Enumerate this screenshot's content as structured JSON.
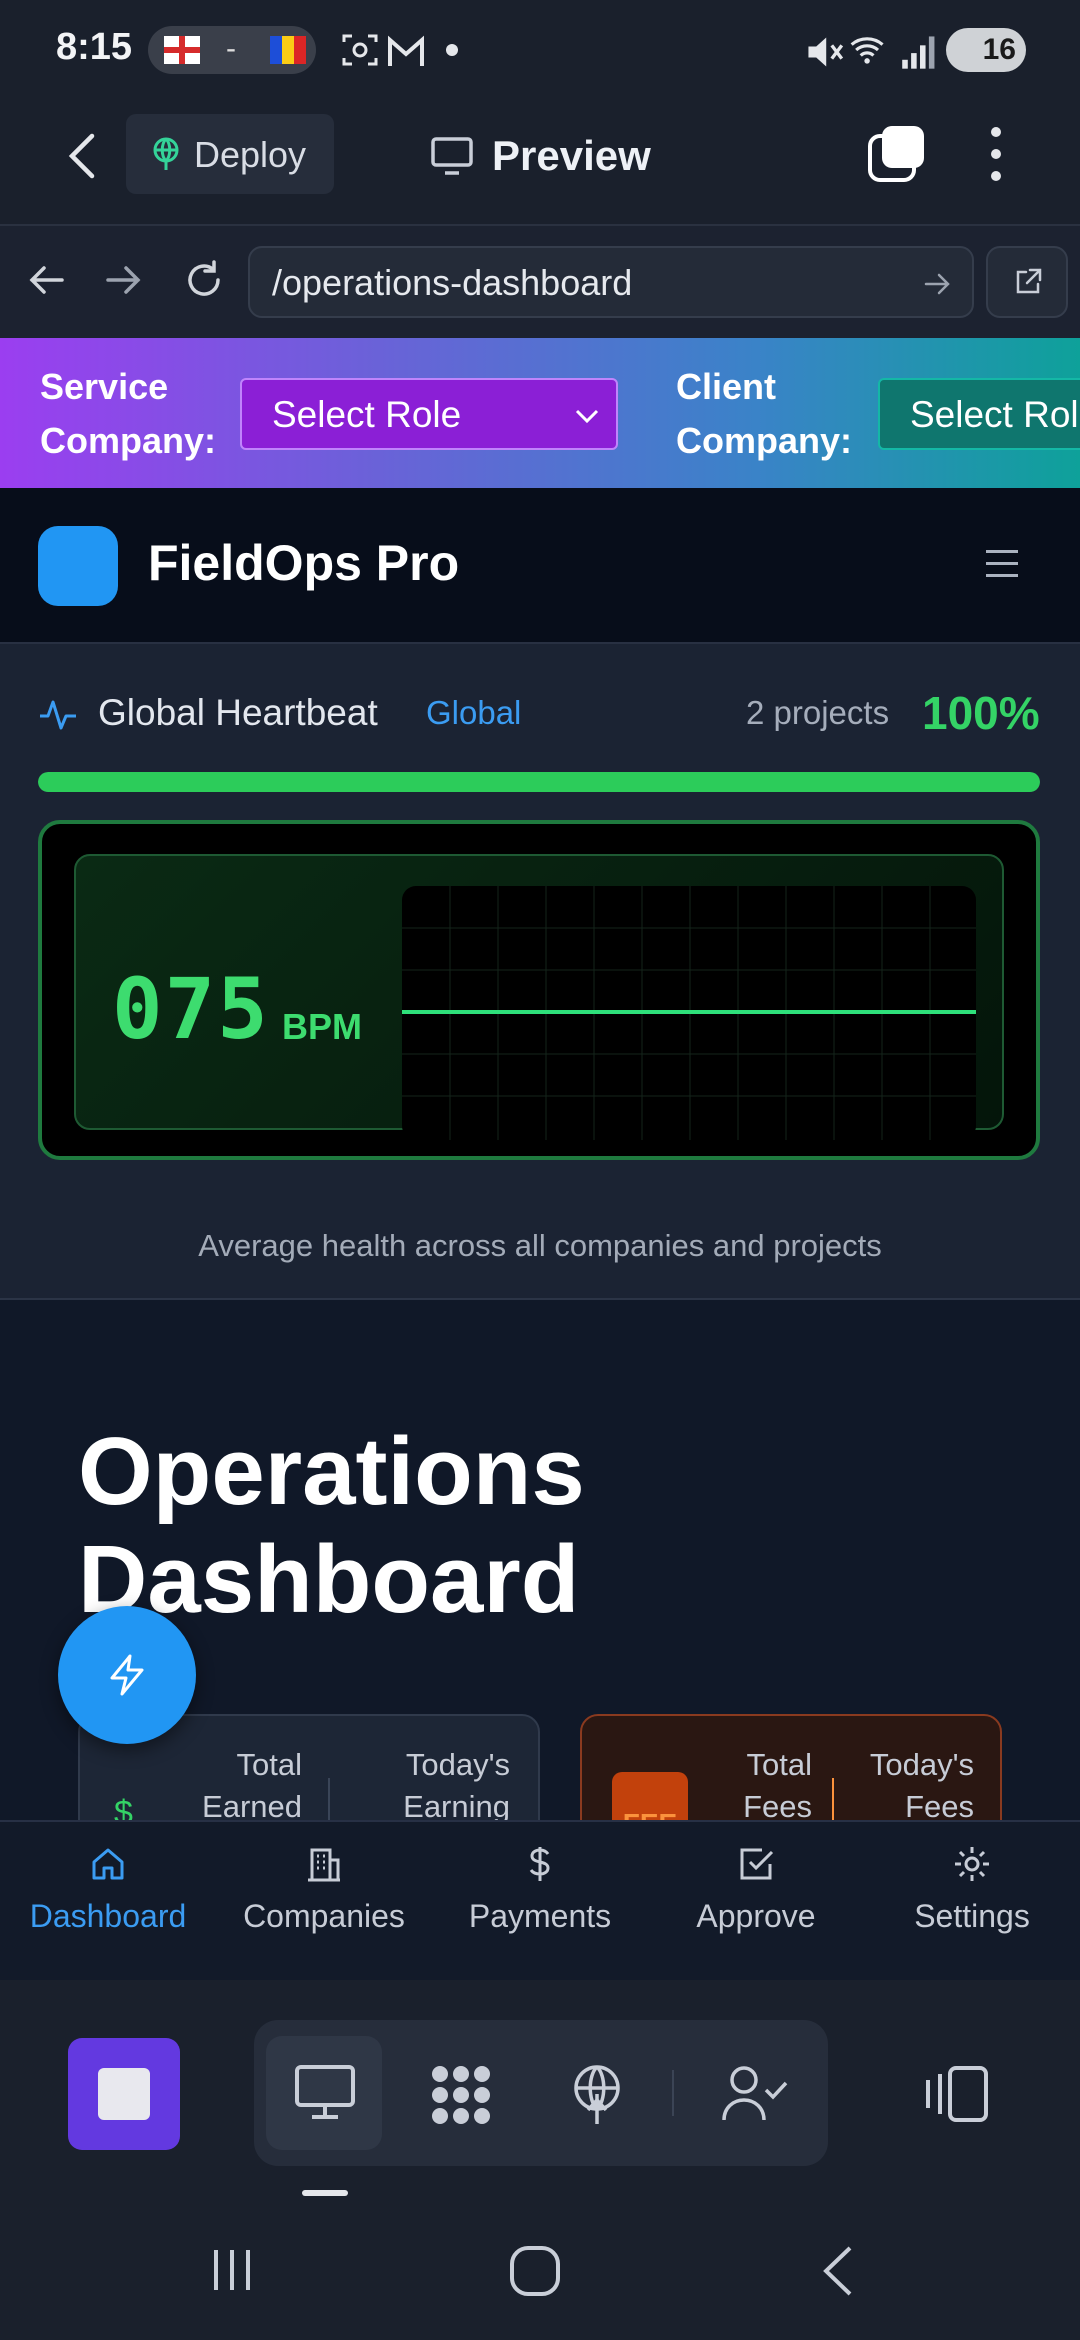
{
  "status_bar": {
    "time": "8:15",
    "flag_separator": "-",
    "battery": "16",
    "icons": [
      "england-flag-icon",
      "andorra-flag-icon",
      "camera-frame-icon",
      "gmail-icon",
      "dot-icon",
      "mute-icon",
      "wifi-icon",
      "signal-icon",
      "battery-icon"
    ]
  },
  "app_header": {
    "deploy_label": "Deploy",
    "preview_label": "Preview"
  },
  "browser": {
    "url": "/operations-dashboard"
  },
  "roles": {
    "service_company_label": "Service Company:",
    "service_select_value": "Select Role",
    "client_company_label": "Client Company:",
    "client_select_value": "Select Role",
    "colors": {
      "service_select_bg": "#8b1fd6",
      "client_select_bg": "#0f766e"
    }
  },
  "brand": {
    "name": "FieldOps Pro",
    "logo_color": "#2196f3"
  },
  "heartbeat": {
    "title": "Global Heartbeat",
    "scope_tag": "Global",
    "projects": "2 projects",
    "health_percent": "100%",
    "health_fraction": 1.0,
    "bpm_value": "075",
    "bpm_unit": "BPM",
    "caption": "Average health across all companies and projects",
    "colors": {
      "good": "#34d366",
      "accent": "#3b9cf2"
    }
  },
  "operations": {
    "title": "Operations Dashboard",
    "earned_card": {
      "icon": "dollar-icon",
      "total_label": "Total Earned",
      "today_label": "Today's Earning"
    },
    "fees_card": {
      "badge": "FEE",
      "total_label": "Total Fees",
      "today_label": "Today's Fees"
    }
  },
  "bottom_nav": {
    "items": [
      {
        "label": "Dashboard",
        "icon": "home-icon",
        "active": true
      },
      {
        "label": "Companies",
        "icon": "building-icon",
        "active": false
      },
      {
        "label": "Payments",
        "icon": "dollar-icon",
        "active": false
      },
      {
        "label": "Approve",
        "icon": "check-square-icon",
        "active": false
      },
      {
        "label": "Settings",
        "icon": "gear-icon",
        "active": false
      }
    ]
  },
  "ide_toolbar": {
    "buttons": [
      "stop-icon",
      "monitor-icon",
      "apps-grid-icon",
      "deploy-globe-icon",
      "user-check-icon",
      "split-view-icon"
    ]
  }
}
